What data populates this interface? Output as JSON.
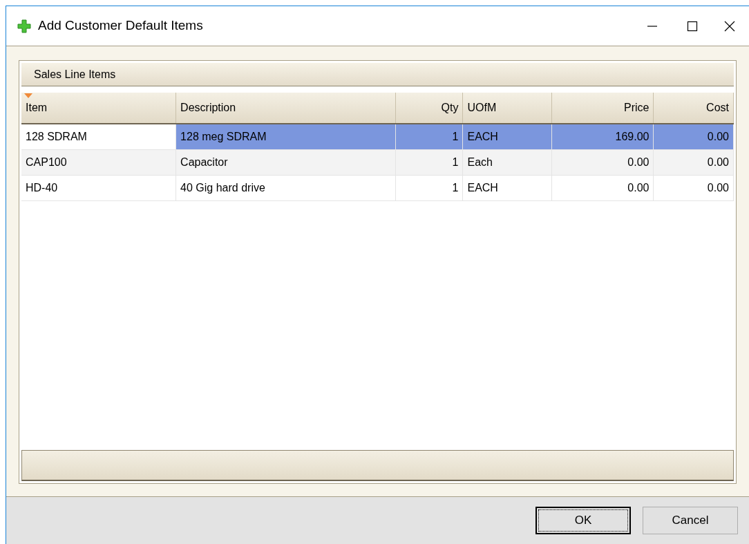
{
  "window": {
    "title": "Add Customer Default Items"
  },
  "group": {
    "title": "Sales Line Items"
  },
  "table": {
    "columns": [
      {
        "label": "Item",
        "sorted": true
      },
      {
        "label": "Description",
        "sorted": false
      },
      {
        "label": "Qty",
        "sorted": false
      },
      {
        "label": "UOfM",
        "sorted": false
      },
      {
        "label": "Price",
        "sorted": false
      },
      {
        "label": "Cost",
        "sorted": false
      }
    ],
    "rows": [
      {
        "selected": true,
        "cells": [
          "128 SDRAM",
          "128 meg SDRAM",
          "1",
          "EACH",
          "169.00",
          "0.00"
        ]
      },
      {
        "selected": false,
        "cells": [
          "CAP100",
          "Capacitor",
          "1",
          "Each",
          "0.00",
          "0.00"
        ]
      },
      {
        "selected": false,
        "cells": [
          "HD-40",
          "40 Gig hard drive",
          "1",
          "EACH",
          "0.00",
          "0.00"
        ]
      }
    ]
  },
  "buttons": [
    {
      "label": "OK",
      "focused": true
    },
    {
      "label": "Cancel",
      "focused": false
    }
  ]
}
